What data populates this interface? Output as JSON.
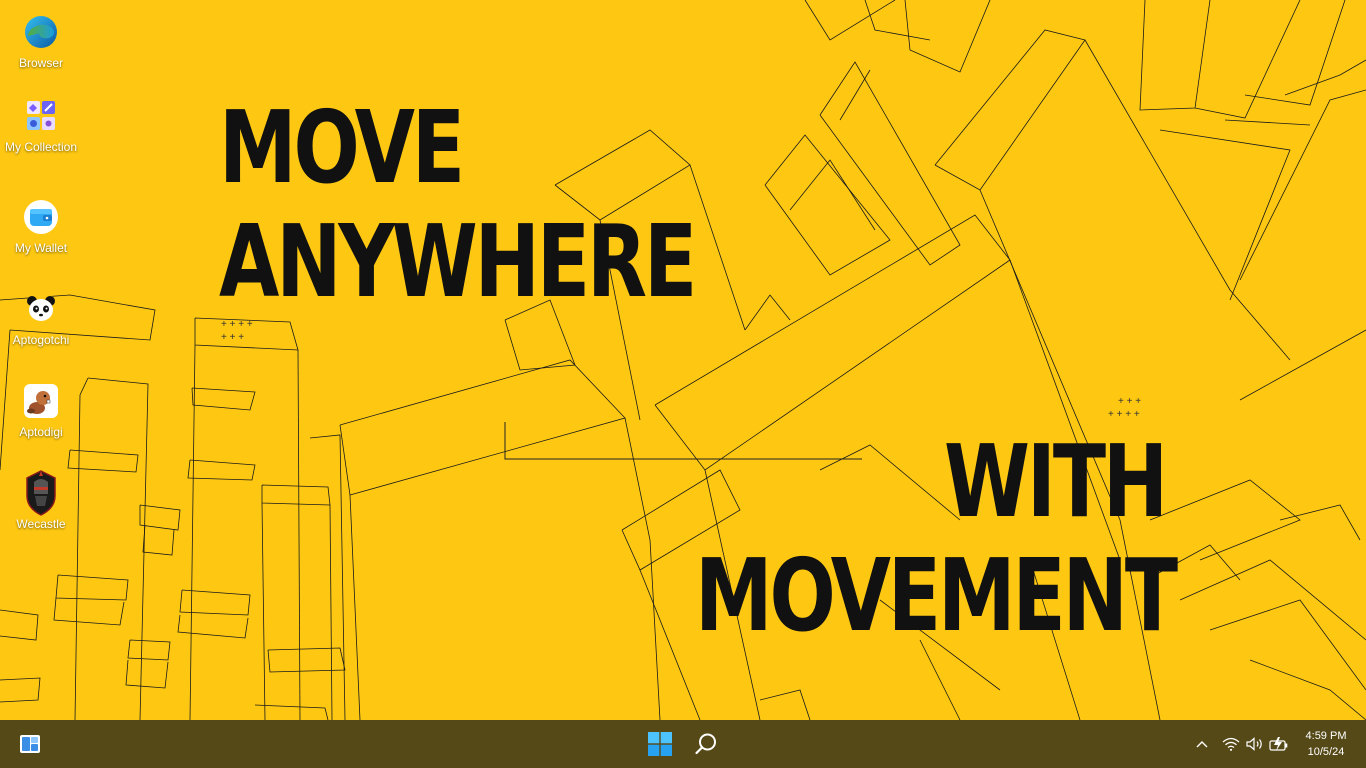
{
  "wallpaper": {
    "background_color": "#fec812",
    "line_color": "#1a1a1a",
    "headline_line1": "MOVE",
    "headline_line2": "ANYWHERE",
    "headline_line3": "WITH",
    "headline_line4": "MOVEMENT",
    "plus_marks_1": "+ + + +",
    "plus_marks_2": "+ + +",
    "plus_marks_3": "+ + +",
    "plus_marks_4": "+ + + +"
  },
  "desktop_icons": [
    {
      "label": "Browser",
      "icon": "edge-browser-icon"
    },
    {
      "label": "My Collection",
      "icon": "collection-icon"
    },
    {
      "label": "My Wallet",
      "icon": "wallet-icon"
    },
    {
      "label": "Aptogotchi",
      "icon": "panda-icon"
    },
    {
      "label": "Aptodigi",
      "icon": "beaver-icon"
    },
    {
      "label": "Wecastle",
      "icon": "knight-icon"
    }
  ],
  "taskbar": {
    "background_color": "#564918",
    "widgets_icon": "widgets-icon",
    "start_icon": "windows-start-icon",
    "search_icon": "search-icon",
    "tray": {
      "chevron_icon": "chevron-up-icon",
      "wifi_icon": "wifi-icon",
      "volume_icon": "volume-icon",
      "battery_icon": "battery-charging-icon"
    },
    "clock": {
      "time": "4:59 PM",
      "date": "10/5/24"
    }
  }
}
